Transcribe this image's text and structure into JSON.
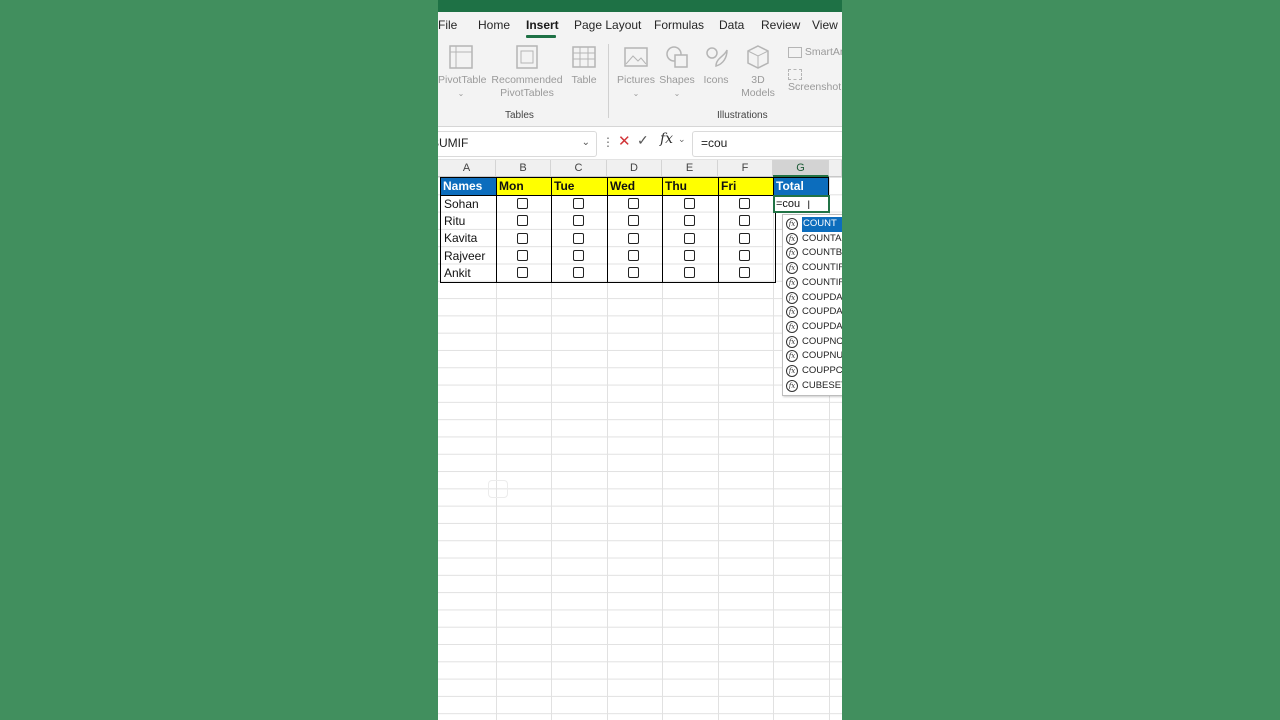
{
  "ribbon": {
    "tabs": [
      "File",
      "Home",
      "Insert",
      "Page Layout",
      "Formulas",
      "Data",
      "Review",
      "View"
    ],
    "active_tab": "Insert",
    "buttons": {
      "pivottable": "PivotTable",
      "recommended_line1": "Recommended",
      "recommended_line2": "PivotTables",
      "table": "Table",
      "pictures": "Pictures",
      "shapes": "Shapes",
      "icons": "Icons",
      "models_line1": "3D",
      "models_line2": "Models",
      "smartart": "SmartArt",
      "screenshot": "Screenshot"
    },
    "groups": {
      "tables": "Tables",
      "illustrations": "Illustrations"
    }
  },
  "formula_bar": {
    "name_box": "SUMIF",
    "formula": "=cou"
  },
  "sheet": {
    "columns": [
      "A",
      "B",
      "C",
      "D",
      "E",
      "F",
      "G"
    ],
    "selected_column": "G",
    "headers": [
      "Names",
      "Mon",
      "Tue",
      "Wed",
      "Thu",
      "Fri",
      "Total"
    ],
    "rows": [
      {
        "name": "Sohan"
      },
      {
        "name": "Ritu"
      },
      {
        "name": "Kavita"
      },
      {
        "name": "Rajveer"
      },
      {
        "name": "Ankit"
      }
    ],
    "active_cell_text": "=cou",
    "colors": {
      "header_yellow": "#ffff00",
      "header_blue": "#0c6dbd",
      "accent": "#217346"
    }
  },
  "autocomplete": {
    "items": [
      "COUNT",
      "COUNTA",
      "COUNTBLANK",
      "COUNTIF",
      "COUNTIFS",
      "COUPDAYBS",
      "COUPDAYS",
      "COUPDAYSNC",
      "COUPNCD",
      "COUPNUM",
      "COUPPCD",
      "CUBESET"
    ],
    "selected": "COUNT",
    "icon": "function-icon"
  }
}
